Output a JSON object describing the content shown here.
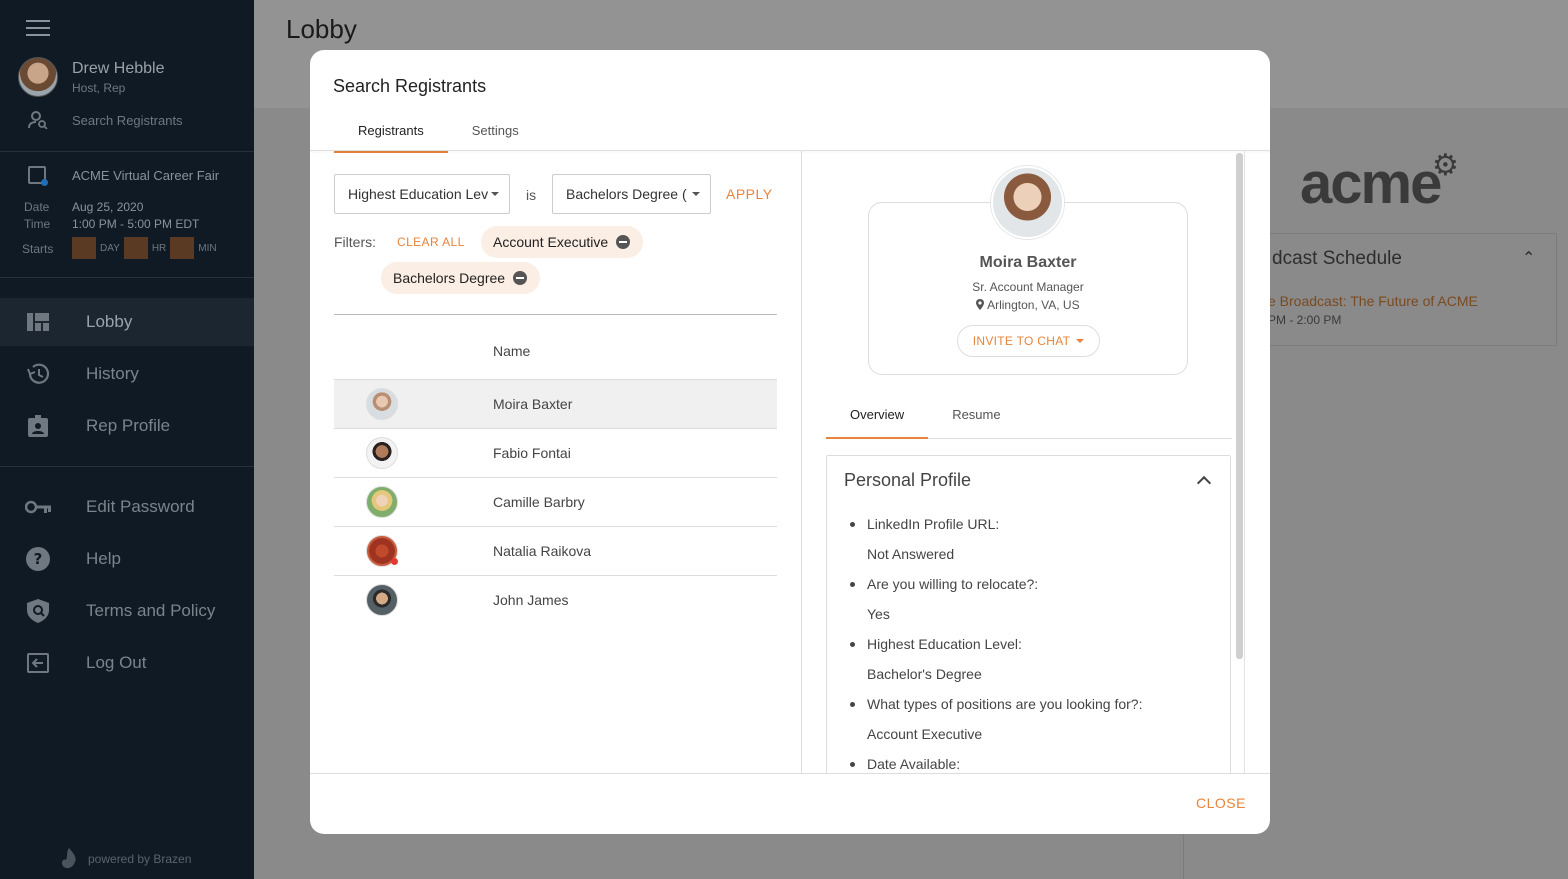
{
  "sidebar": {
    "user": {
      "name": "Drew Hebble",
      "role": "Host, Rep"
    },
    "search_link": "Search Registrants",
    "event": {
      "name": "ACME Virtual Career Fair",
      "date_label": "Date",
      "date_value": "Aug 25, 2020",
      "time_label": "Time",
      "time_value": "1:00 PM - 5:00 PM EDT",
      "starts_label": "Starts",
      "countdown": {
        "day_label": "DAY",
        "hr_label": "HR",
        "min_label": "MIN"
      }
    },
    "nav": [
      {
        "label": "Lobby",
        "icon": "dashboard-icon",
        "active": true
      },
      {
        "label": "History",
        "icon": "history-icon"
      },
      {
        "label": "Rep Profile",
        "icon": "badge-icon"
      }
    ],
    "nav2": [
      {
        "label": "Edit Password",
        "icon": "key-icon"
      },
      {
        "label": "Help",
        "icon": "help-icon"
      },
      {
        "label": "Terms and Policy",
        "icon": "shield-icon"
      },
      {
        "label": "Log Out",
        "icon": "logout-icon"
      }
    ],
    "powered_by": "powered by Brazen"
  },
  "main": {
    "title": "Lobby",
    "logo_text": "acme",
    "schedule": {
      "title": "dcast Schedule",
      "broadcast": "e Broadcast: The Future of ACME",
      "time": "PM - 2:00 PM"
    }
  },
  "modal": {
    "title": "Search Registrants",
    "tabs": [
      {
        "label": "Registrants",
        "active": true
      },
      {
        "label": "Settings"
      }
    ],
    "filter": {
      "field": "Highest Education Lev",
      "operator": "is",
      "value": "Bachelors Degree (",
      "apply": "APPLY",
      "filters_label": "Filters:",
      "clear_all": "CLEAR ALL",
      "chips": [
        "Account Executive",
        "Bachelors Degree"
      ]
    },
    "table": {
      "name_header": "Name",
      "rows": [
        {
          "name": "Moira Baxter",
          "selected": true
        },
        {
          "name": "Fabio Fontai"
        },
        {
          "name": "Camille Barbry"
        },
        {
          "name": "Natalia Raikova",
          "online": true
        },
        {
          "name": "John James"
        }
      ]
    },
    "profile": {
      "name": "Moira Baxter",
      "title": "Sr. Account Manager",
      "location": "Arlington, VA, US",
      "invite": "INVITE TO CHAT",
      "tabs": [
        {
          "label": "Overview",
          "active": true
        },
        {
          "label": "Resume"
        }
      ],
      "section_title": "Personal Profile",
      "qa": [
        {
          "q": "LinkedIn Profile URL:",
          "a": "Not Answered"
        },
        {
          "q": "Are you willing to relocate?:",
          "a": "Yes"
        },
        {
          "q": "Highest Education Level:",
          "a": "Bachelor's Degree"
        },
        {
          "q": "What types of positions are you looking for?:",
          "a": "Account Executive"
        },
        {
          "q": "Date Available:",
          "a": ""
        }
      ]
    },
    "close": "CLOSE"
  },
  "colors": {
    "accent": "#e8833a",
    "sidebar_bg": "#0f1a24"
  }
}
